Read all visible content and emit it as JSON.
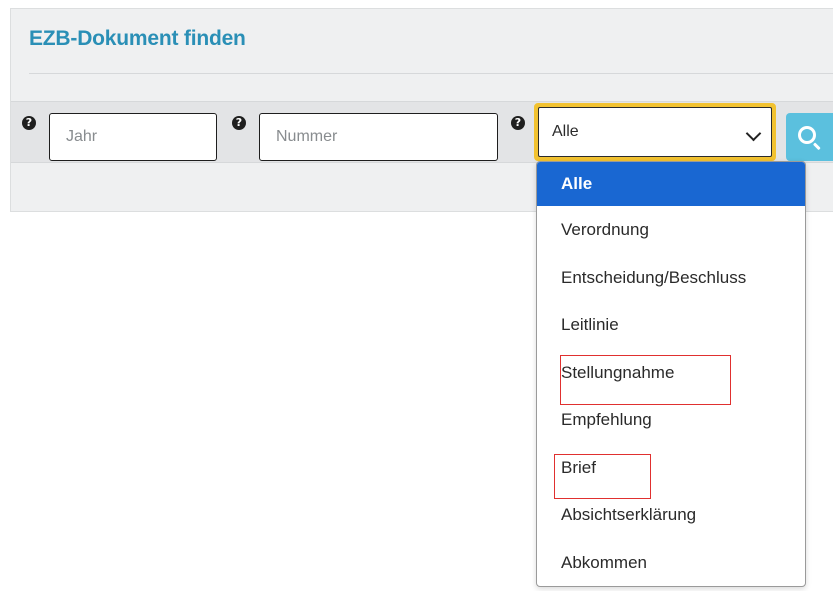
{
  "panel": {
    "title": "EZB-Dokument finden"
  },
  "search": {
    "year_placeholder": "Jahr",
    "number_placeholder": "Nummer",
    "type_selected": "Alle",
    "help_icon": "question-circle-icon",
    "search_icon": "search-icon"
  },
  "dropdown": {
    "options": [
      "Alle",
      "Verordnung",
      "Entscheidung/Beschluss",
      "Leitlinie",
      "Stellungnahme",
      "Empfehlung",
      "Brief",
      "Absichtserklärung",
      "Abkommen"
    ],
    "selected_index": 0,
    "highlighted_options": [
      "Stellungnahme",
      "Brief"
    ]
  },
  "colors": {
    "title": "#2a8fb6",
    "focus_border": "#f2c230",
    "search_button": "#5bc0de",
    "selected_option": "#1967d2",
    "annotation_box": "#e0302f"
  }
}
